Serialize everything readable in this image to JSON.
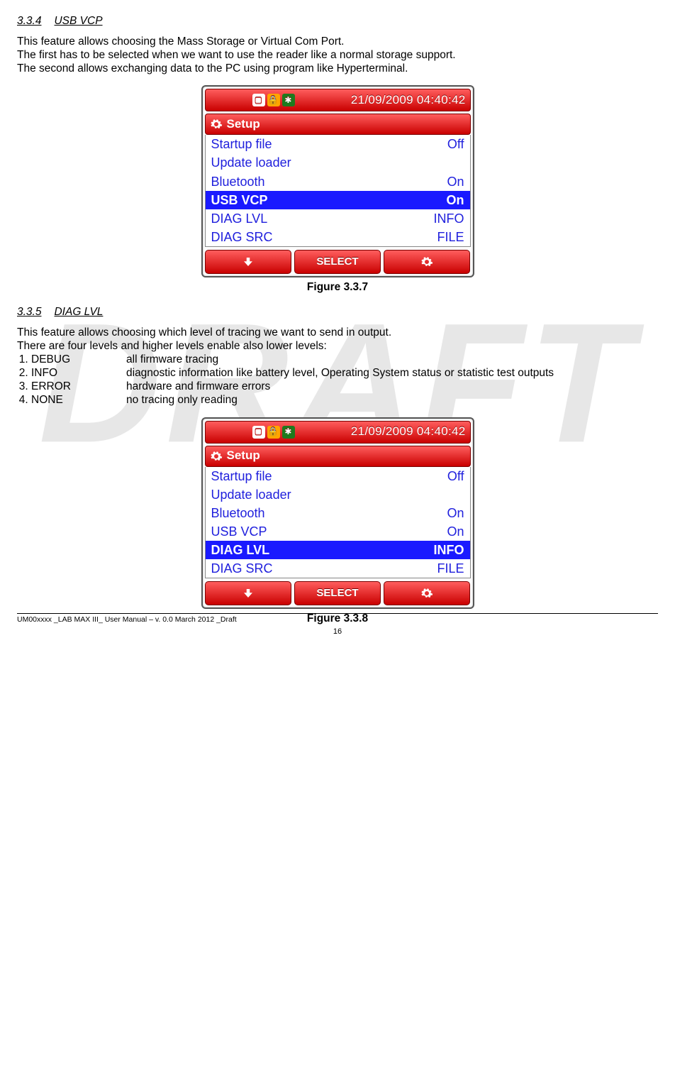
{
  "watermark": "DRAFT",
  "s334": {
    "num": "3.3.4",
    "title": "USB VCP",
    "p1": "This feature allows choosing the Mass Storage or Virtual Com Port.",
    "p2": "The first has to be selected when we want to use the reader like a normal storage support.",
    "p3": "The second allows exchanging data to the PC using program like Hyperterminal."
  },
  "device1": {
    "datetime": "21/09/2009 04:40:42",
    "setup_label": "Setup",
    "rows": [
      {
        "label": "Startup file",
        "value": "Off"
      },
      {
        "label": "Update loader",
        "value": ""
      },
      {
        "label": "Bluetooth",
        "value": "On"
      },
      {
        "label": "USB VCP",
        "value": "On"
      },
      {
        "label": "DIAG LVL",
        "value": "INFO"
      },
      {
        "label": "DIAG SRC",
        "value": "FILE"
      }
    ],
    "selected_index": 3,
    "btn_select": "SELECT"
  },
  "fig1": "Figure 3.3.7",
  "s335": {
    "num": "3.3.5",
    "title": "DIAG LVL",
    "p1": "This feature allows choosing which level of tracing we want to send in output.",
    "p2": "There are four levels and higher levels enable also lower levels:",
    "levels": [
      {
        "name": "DEBUG",
        "desc": "all firmware tracing"
      },
      {
        "name": "INFO",
        "desc": "diagnostic information like battery level, Operating System status or statistic test outputs"
      },
      {
        "name": "ERROR",
        "desc": "hardware and firmware errors"
      },
      {
        "name": "NONE",
        "desc": "no tracing only reading"
      }
    ]
  },
  "device2": {
    "datetime": "21/09/2009 04:40:42",
    "setup_label": "Setup",
    "rows": [
      {
        "label": "Startup file",
        "value": "Off"
      },
      {
        "label": "Update loader",
        "value": ""
      },
      {
        "label": "Bluetooth",
        "value": "On"
      },
      {
        "label": "USB VCP",
        "value": "On"
      },
      {
        "label": "DIAG LVL",
        "value": "INFO"
      },
      {
        "label": "DIAG SRC",
        "value": "FILE"
      }
    ],
    "selected_index": 4,
    "btn_select": "SELECT"
  },
  "fig2": "Figure 3.3.8",
  "footer_text": "UM00xxxx _LAB MAX III_ User Manual – v. 0.0 March 2012 _Draft",
  "page_number": "16"
}
